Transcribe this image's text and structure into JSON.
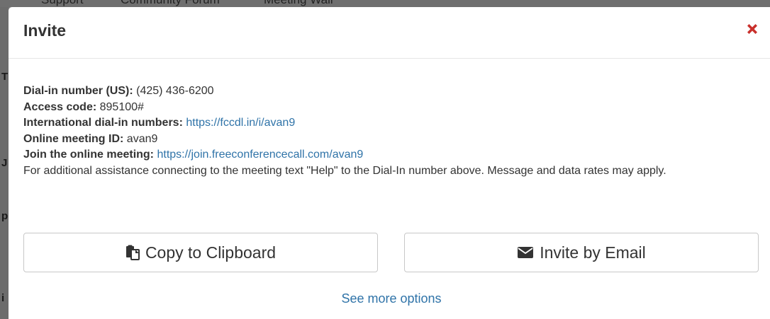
{
  "background": {
    "nav_items": [
      "Support",
      "Community Forum",
      "Meeting Wall"
    ],
    "edge_letters": [
      "T",
      "J",
      "p",
      "i"
    ]
  },
  "modal": {
    "title": "Invite",
    "close_icon": "close-x-icon",
    "accent_color": "#2f73a8",
    "close_color": "#c9302c",
    "details": {
      "dial_in": {
        "label": "Dial-in number (US):",
        "value": "(425) 436-6200"
      },
      "access_code": {
        "label": "Access code:",
        "value": "895100#"
      },
      "international": {
        "label": "International dial-in numbers:",
        "value": "https://fccdl.in/i/avan9"
      },
      "meeting_id": {
        "label": "Online meeting ID:",
        "value": "avan9"
      },
      "join": {
        "label": "Join the online meeting:",
        "value": "https://join.freeconferencecall.com/avan9"
      },
      "note": "For additional assistance connecting to the meeting text \"Help\" to the Dial-In number above. Message and data rates may apply."
    },
    "buttons": {
      "copy": {
        "label": "Copy to Clipboard",
        "icon": "clipboard-icon"
      },
      "email": {
        "label": "Invite by Email",
        "icon": "envelope-icon"
      }
    },
    "see_more": "See more options"
  }
}
